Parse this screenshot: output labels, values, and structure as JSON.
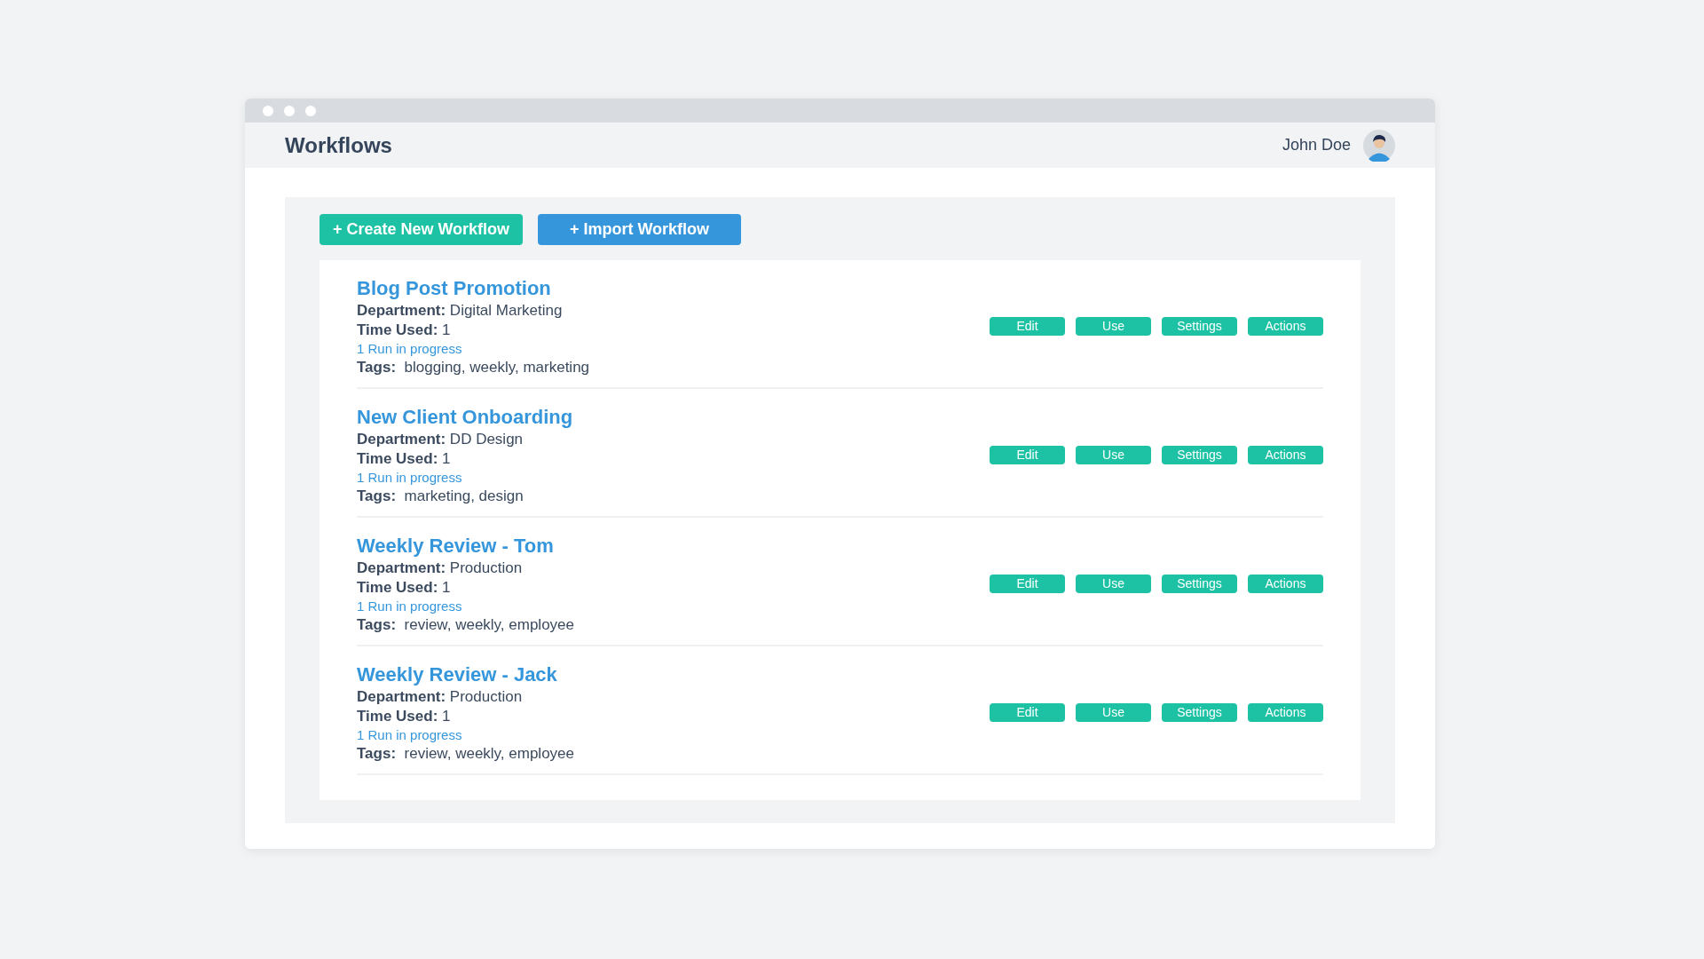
{
  "header": {
    "title": "Workflows",
    "user_name": "John Doe"
  },
  "toolbar": {
    "buttons": [
      {
        "label": "+ Create New Workflow",
        "kind": "create"
      },
      {
        "label": "+ Import Workflow",
        "kind": "import"
      }
    ]
  },
  "workflows": [
    {
      "name": "Blog Post Promotion",
      "department": "**Department:** Digital Marketing",
      "time_used": "**Time Used:** 1",
      "runs": "1 Run in progress",
      "tags": "**Tags:**  blogging, weekly, marketing",
      "actions": [
        "Edit",
        "Use",
        "Settings",
        "Actions"
      ]
    },
    {
      "name": "New Client Onboarding",
      "department": "**Department:** DD Design",
      "time_used": "**Time Used:** 1",
      "runs": "1 Run in progress",
      "tags": "**Tags:**  marketing, design",
      "actions": [
        "Edit",
        "Use",
        "Settings",
        "Actions"
      ]
    },
    {
      "name": "Weekly Review - Tom",
      "department": "**Department:** Production",
      "time_used": "**Time Used:** 1",
      "runs": "1 Run in progress",
      "tags": "**Tags:**  review, weekly, employee",
      "actions": [
        "Edit",
        "Use",
        "Settings",
        "Actions"
      ]
    },
    {
      "name": "Weekly Review - Jack",
      "department": "**Department:** Production",
      "time_used": "**Time Used:** 1",
      "runs": "1 Run in progress",
      "tags": "**Tags:**  review, weekly, employee",
      "actions": [
        "Edit",
        "Use",
        "Settings",
        "Actions"
      ]
    }
  ]
}
